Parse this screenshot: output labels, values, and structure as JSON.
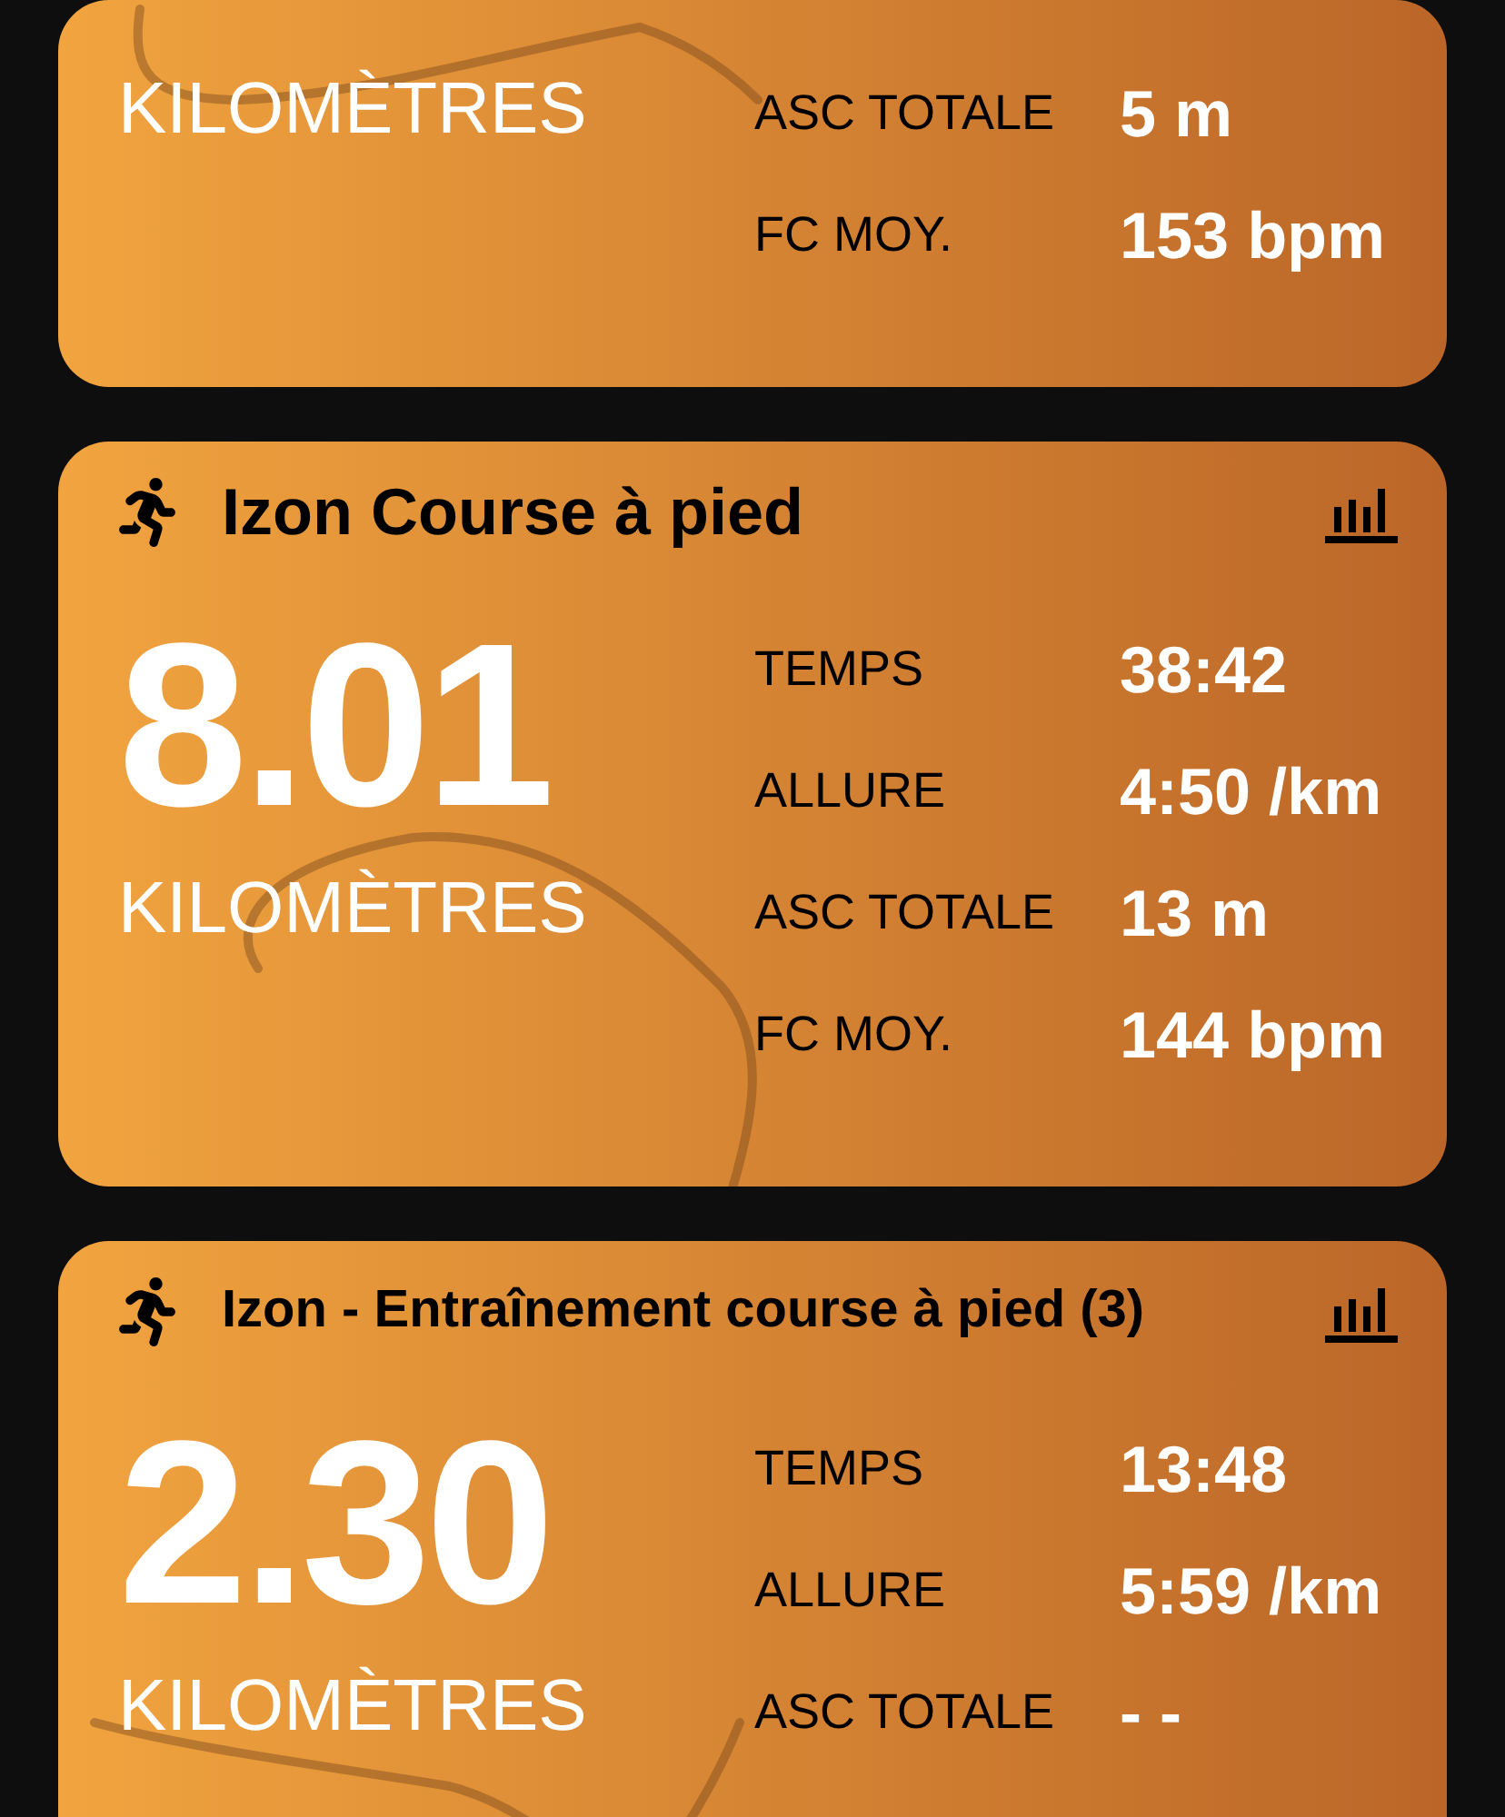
{
  "activities": [
    {
      "unit": "KILOMÈTRES",
      "stats": [
        {
          "label": "ASC TOTALE",
          "value": "5 m"
        },
        {
          "label": "FC MOY.",
          "value": "153 bpm"
        }
      ]
    },
    {
      "title": "Izon Course à pied",
      "distance": "8.01",
      "unit": "KILOMÈTRES",
      "stats": [
        {
          "label": "TEMPS",
          "value": "38:42"
        },
        {
          "label": "ALLURE",
          "value": "4:50 /km"
        },
        {
          "label": "ASC TOTALE",
          "value": "13 m"
        },
        {
          "label": "FC MOY.",
          "value": "144 bpm"
        }
      ]
    },
    {
      "title": "Izon - Entraînement course à pied (3)",
      "distance": "2.30",
      "unit": "KILOMÈTRES",
      "stats": [
        {
          "label": "TEMPS",
          "value": "13:48"
        },
        {
          "label": "ALLURE",
          "value": "5:59 /km"
        },
        {
          "label": "ASC TOTALE",
          "value": "- -"
        }
      ]
    }
  ]
}
